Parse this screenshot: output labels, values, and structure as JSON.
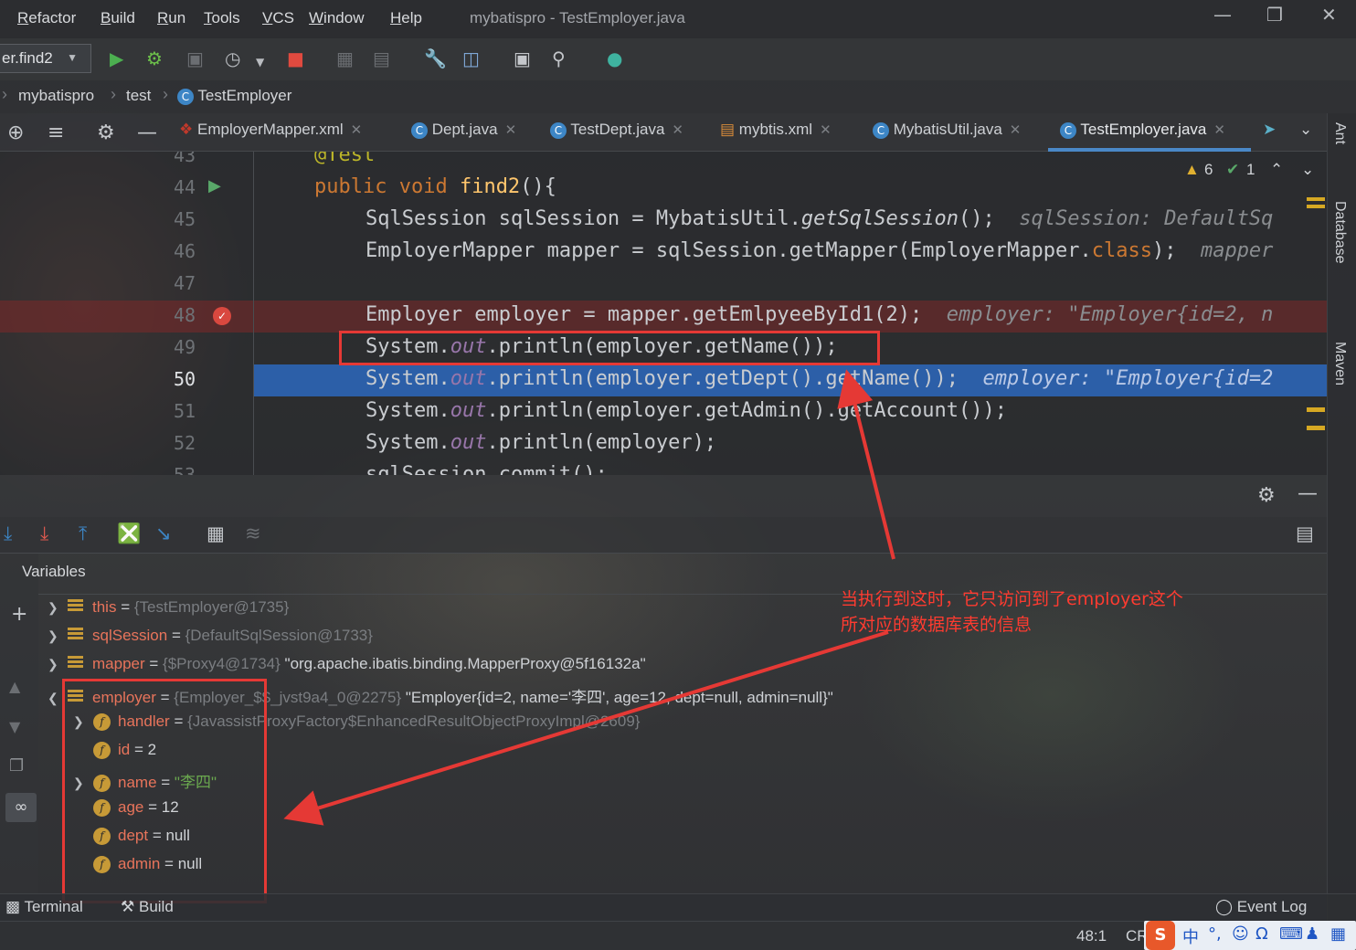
{
  "menu": {
    "items": [
      "Refactor",
      "Build",
      "Run",
      "Tools",
      "VCS",
      "Window",
      "Help"
    ],
    "window_title": "mybatispro - TestEmployer.java"
  },
  "toolbar": {
    "run_config": "er.find2"
  },
  "breadcrumb": [
    "mybatispro",
    "test",
    "TestEmployer"
  ],
  "tabs": [
    {
      "label": "EmployerMapper.xml",
      "icon": "xml-icon"
    },
    {
      "label": "Dept.java",
      "icon": "class-icon"
    },
    {
      "label": "TestDept.java",
      "icon": "class-icon"
    },
    {
      "label": "mybtis.xml",
      "icon": "xml-icon"
    },
    {
      "label": "MybatisUtil.java",
      "icon": "class-icon"
    },
    {
      "label": "TestEmployer.java",
      "icon": "class-icon",
      "active": true
    }
  ],
  "inspection": {
    "warnings": "6",
    "ok": "1"
  },
  "right_strip": [
    "Ant",
    "Database",
    "Maven"
  ],
  "code": {
    "l43": {
      "num": "43",
      "text": "@Test"
    },
    "l44": {
      "num": "44",
      "kw": "public void ",
      "fn": "find2",
      "rest": "(){"
    },
    "l45": {
      "num": "45",
      "a": "SqlSession sqlSession = MybatisUtil.",
      "b": "getSqlSession",
      "c": "();",
      "hint": "sqlSession: DefaultSq"
    },
    "l46": {
      "num": "46",
      "a": "EmployerMapper mapper = sqlSession.getMapper(EmployerMapper.",
      "b": "class",
      "c": ");",
      "hint": "mapper"
    },
    "l47": {
      "num": "47"
    },
    "l48": {
      "num": "48",
      "a": "Employer employer = mapper.getEmlpyeeById1(2);",
      "hint": "employer: \"Employer{id=2, n"
    },
    "l49": {
      "num": "49",
      "a": "System.",
      "b": "out",
      "c": ".println(employer.getName());"
    },
    "l50": {
      "num": "50",
      "a": "System.",
      "b": "out",
      "c": ".println(employer.getDept().getName());",
      "hint": "employer: \"Employer{id=2"
    },
    "l51": {
      "num": "51",
      "a": "System.",
      "b": "out",
      "c": ".println(employer.getAdmin().getAccount());"
    },
    "l52": {
      "num": "52",
      "a": "System.",
      "b": "out",
      "c": ".println(employer);"
    },
    "l53": {
      "num": "53",
      "text": "sqlSession.commit();"
    }
  },
  "debug": {
    "variables_title": "Variables",
    "vars": [
      {
        "name": "this",
        "eq": " = ",
        "ref": "{TestEmployer@1735}",
        "val": ""
      },
      {
        "name": "sqlSession",
        "eq": " = ",
        "ref": "{DefaultSqlSession@1733}",
        "val": ""
      },
      {
        "name": "mapper",
        "eq": " = ",
        "ref": "{$Proxy4@1734}",
        "val": " \"org.apache.ibatis.binding.MapperProxy@5f16132a\""
      },
      {
        "name": "employer",
        "eq": " = ",
        "ref": "{Employer_$$_jvst9a4_0@2275}",
        "val": " \"Employer{id=2, name='李四', age=12, dept=null, admin=null}\""
      }
    ],
    "fields": [
      {
        "name": "handler",
        "eq": " = ",
        "ref": "{JavassistProxyFactory$EnhancedResultObjectProxyImpl@2609}",
        "val": ""
      },
      {
        "name": "id",
        "eq": " = ",
        "ref": "",
        "val": "2"
      },
      {
        "name": "name",
        "eq": " = ",
        "ref": "",
        "val": "\"李四\""
      },
      {
        "name": "age",
        "eq": " = ",
        "ref": "",
        "val": "12"
      },
      {
        "name": "dept",
        "eq": " = ",
        "ref": "",
        "val": "null"
      },
      {
        "name": "admin",
        "eq": " = ",
        "ref": "",
        "val": "null"
      }
    ]
  },
  "annotation": {
    "line1": "当执行到这时，它只访问到了employer这个",
    "line2": "所对应的数据库表的信息"
  },
  "bottom": {
    "terminal": "Terminal",
    "build": "Build",
    "event_log": "Event Log"
  },
  "status": {
    "position": "48:1",
    "crlf": "CR"
  },
  "colors": {
    "accent": "#4a88c7",
    "annotation_red": "#e53935",
    "exec_line": "#2c5fa8"
  }
}
